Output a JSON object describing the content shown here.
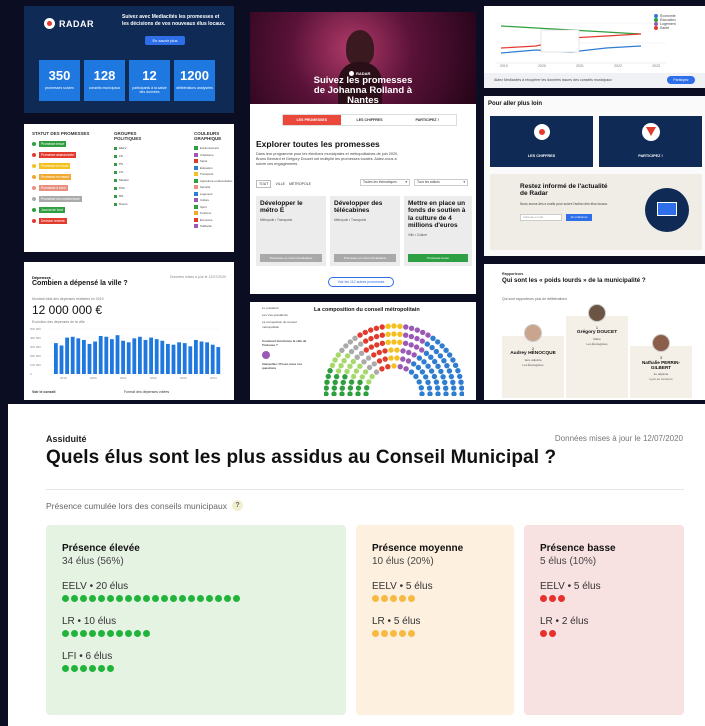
{
  "radar_promo": {
    "logo": "RADAR",
    "headline": "Suivez avec Mediacités les promesses et les décisions de vos nouveaux élus locaux.",
    "cta": "En savoir plus",
    "stats": [
      {
        "value": "350",
        "label": "promesses suivies"
      },
      {
        "value": "128",
        "label": "conseils municipaux"
      },
      {
        "value": "12",
        "label": "participants à la saisie des données"
      },
      {
        "value": "1200",
        "label": "délibérations analysées"
      }
    ]
  },
  "hero": {
    "logo": "RADAR",
    "title": "Suivez les promesses de Johanna Rolland à Nantes",
    "tabs": [
      "LES PROMESSES",
      "LES CHIFFRES",
      "PARTICIPEZ !"
    ]
  },
  "legend_card": {
    "col1_title": "STATUT DES PROMESSES",
    "col2_title": "GROUPES POLITIQUES",
    "col3_title": "COULEURS GRAPHIQUE",
    "statuses": [
      "Promesse tenue",
      "Promesse abandonnée",
      "Promesse en cours",
      "Promesse en retard",
      "Promesse à venir",
      "Promesse non commencée",
      "Journal de bord",
      "Décision récente"
    ],
    "status_colors": [
      "#2e9e3e",
      "#e23b2e",
      "#f4c020",
      "#f0a830",
      "#e89080",
      "#aaaaaa",
      "#2e9e3e",
      "#e23b2e"
    ],
    "groups": [
      "EELV",
      "LR",
      "PS",
      "LFI",
      "Modem",
      "PCF",
      "RN",
      "Divers"
    ],
    "graph_colors": [
      "Environnement",
      "Urbanisme",
      "Santé",
      "Éducation",
      "Transports",
      "Agriculture et alimentation",
      "Sécurité",
      "Logement",
      "Culture",
      "Sport",
      "Tourisme",
      "Économie",
      "Solidarité"
    ]
  },
  "top_chart": {
    "legend": [
      "Économie",
      "Éducation",
      "Logement",
      "Santé"
    ],
    "legend_colors": [
      "#2e7dd1",
      "#2e9e3e",
      "#9b59b6",
      "#e23b2e"
    ],
    "years": [
      "2019",
      "2020",
      "2021",
      "2022",
      "2023"
    ],
    "note": "Aidez Mediacités à récupérer les données issues des conseils municipaux",
    "cta": "Participez"
  },
  "budget": {
    "category": "Dépenses",
    "title": "Combien a dépensé la ville ?",
    "updated": "Données mises à jour le 12/07/2020",
    "subtitle": "Montant total des dépenses réalisées en 2019",
    "amount": "12 000 000 €",
    "chart_label": "Evolution des dépenses de la ville",
    "y_ticks": [
      "500 000",
      "400 000",
      "300 000",
      "200 000",
      "100 000",
      "0"
    ],
    "x_ticks": [
      "2019",
      "2020",
      "2021",
      "2022",
      "2023",
      "2024"
    ],
    "footer_left": "Voir le conseil",
    "footer_right": "Format des dépenses votées"
  },
  "explorer": {
    "title": "Explorer toutes les promesses",
    "intro": "Dans leur programme pour les élections municipales et métropolitaines de juin 2020, Bruno Bernard et Grégory Doucet ont multiplié les promesses locales. Aidez-nous à suivre ces engagements.",
    "filters": [
      "TOUT",
      "VILLE",
      "MÉTROPOLE"
    ],
    "select_theme": "Toutes les thématiques",
    "select_status": "Tous les statuts",
    "cards": [
      {
        "title": "Développer le métro E",
        "meta": "Métropole • Transports",
        "button": "Promesse en cours d'évaluation"
      },
      {
        "title": "Développer des télécabines",
        "meta": "Métropole • Transports",
        "button": "Promesse en cours d'évaluation"
      },
      {
        "title": "Mettre en place un fonds de soutien à la culture de 4 millions d'euros",
        "meta": "Ville • Culture",
        "button": "Promesse tenue"
      }
    ],
    "more": "Voir les 112 autres promesses"
  },
  "composition": {
    "title": "La composition du conseil métropolitain",
    "left_items": [
      "Le président",
      "Les vice-présidents",
      "La composition du conseil métropolitain"
    ],
    "question": "Comment fonctionne la ville de Toulouse ?",
    "invite": "Interpellez / Posez-nous vos questions"
  },
  "further": {
    "title": "Pour aller plus loin",
    "tiles": [
      "LES CHIFFRES",
      "PARTICIPEZ !"
    ],
    "newsletter_title": "Restez informé de l'actualité de Radar",
    "newsletter_text": "Nous avons des e-mails pour suivre l'action des élus locaux.",
    "email_placeholder": "Adresse e-mail",
    "subscribe": "Je m'abonne"
  },
  "heavyweights": {
    "category": "Rapporteurs",
    "title": "Qui sont les « poids lourds » de la municipalité ?",
    "subtitle": "Qui sont rapporteurs plus de délibérations",
    "people": [
      {
        "rank": "2",
        "name": "Audrey HÉNOCQUE",
        "role": "1ère adjointe",
        "party": "Les Écologistes"
      },
      {
        "rank": "1",
        "name": "Grégory DOUCET",
        "role": "Maire",
        "party": "Les Écologistes"
      },
      {
        "rank": "3",
        "name": "Nathalie PERRIN-GILBERT",
        "role": "4e adjointe",
        "party": "Lyon en commun"
      }
    ]
  },
  "assiduite": {
    "category": "Assiduité",
    "updated": "Données mises à jour le 12/07/2020",
    "title": "Quels élus sont les plus assidus au Conseil Municipal ?",
    "presence_label": "Présence cumulée lors des conseils municipaux",
    "help": "?",
    "groups": [
      {
        "title": "Présence élevée",
        "summary": "34 élus (56%)",
        "bg": "#e5f3e3",
        "dot": "#22b43a",
        "parties": [
          {
            "label": "EELV • 20 élus",
            "count": 20
          },
          {
            "label": "LR • 10 élus",
            "count": 10
          },
          {
            "label": "LFI • 6 élus",
            "count": 6
          }
        ]
      },
      {
        "title": "Présence moyenne",
        "summary": "10 élus (20%)",
        "bg": "#fdf0df",
        "dot": "#f7b941",
        "parties": [
          {
            "label": "EELV • 5 élus",
            "count": 5
          },
          {
            "label": "LR • 5 élus",
            "count": 5
          }
        ]
      },
      {
        "title": "Présence basse",
        "summary": "5 élus (10%)",
        "bg": "#f7e1e1",
        "dot": "#e8302c",
        "parties": [
          {
            "label": "EELV • 5 élus",
            "count": 3
          },
          {
            "label": "LR • 2 élus",
            "count": 2
          }
        ]
      }
    ]
  }
}
